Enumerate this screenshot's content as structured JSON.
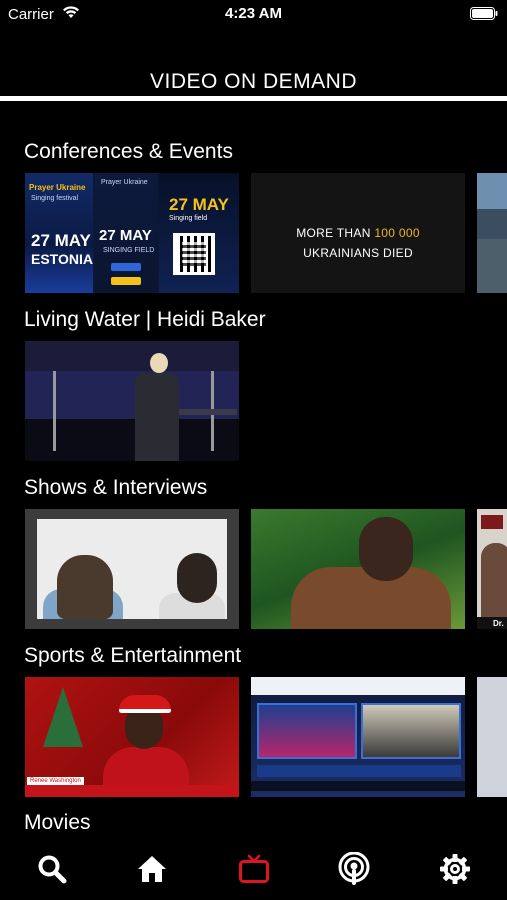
{
  "status_bar": {
    "carrier": "Carrier",
    "time": "4:23 AM"
  },
  "header": {
    "title": "VIDEO ON DEMAND"
  },
  "sections": [
    {
      "title": "Conferences & Events",
      "thumbnails": [
        {
          "name": "Prayer for Ukraine Estonia poster",
          "text": {
            "brand": "Prayer Ukraine",
            "sub": "Singing festival",
            "date1": "27 MAY",
            "place1": "ESTONIA",
            "date2": "27 MAY",
            "place2": "SINGING FIELD",
            "date3": "27 MAY",
            "place3": "Singing field"
          }
        },
        {
          "name": "More than 100 000 Ukrainians died",
          "text": {
            "line1a": "MORE THAN",
            "line1b": "100 000",
            "line2": "UKRAINIANS DIED"
          }
        },
        {
          "name": "Crowd at singing field"
        }
      ]
    },
    {
      "title": "Living Water | Heidi Baker",
      "thumbnails": [
        {
          "name": "Heidi Baker speaking on stage"
        }
      ]
    },
    {
      "title": "Shows & Interviews",
      "thumbnails": [
        {
          "name": "Video call interview"
        },
        {
          "name": "Man in brown coat interview"
        },
        {
          "name": "Studio interview",
          "text": {
            "label": "Dr."
          }
        }
      ]
    },
    {
      "title": "Sports & Entertainment",
      "thumbnails": [
        {
          "name": "Christmas livestream",
          "text": {
            "name_tag": "Renee Washington"
          }
        },
        {
          "name": "Fox Sports Radio stream"
        },
        {
          "name": "Sports stream partial"
        }
      ]
    },
    {
      "title": "Movies",
      "thumbnails": []
    }
  ],
  "tab_bar": {
    "items": [
      {
        "icon": "search-icon",
        "active": false
      },
      {
        "icon": "home-icon",
        "active": false
      },
      {
        "icon": "tv-icon",
        "active": true
      },
      {
        "icon": "podcast-icon",
        "active": false
      },
      {
        "icon": "gear-icon",
        "active": false
      }
    ],
    "active_color": "#e0141e",
    "inactive_color": "#ffffff"
  }
}
